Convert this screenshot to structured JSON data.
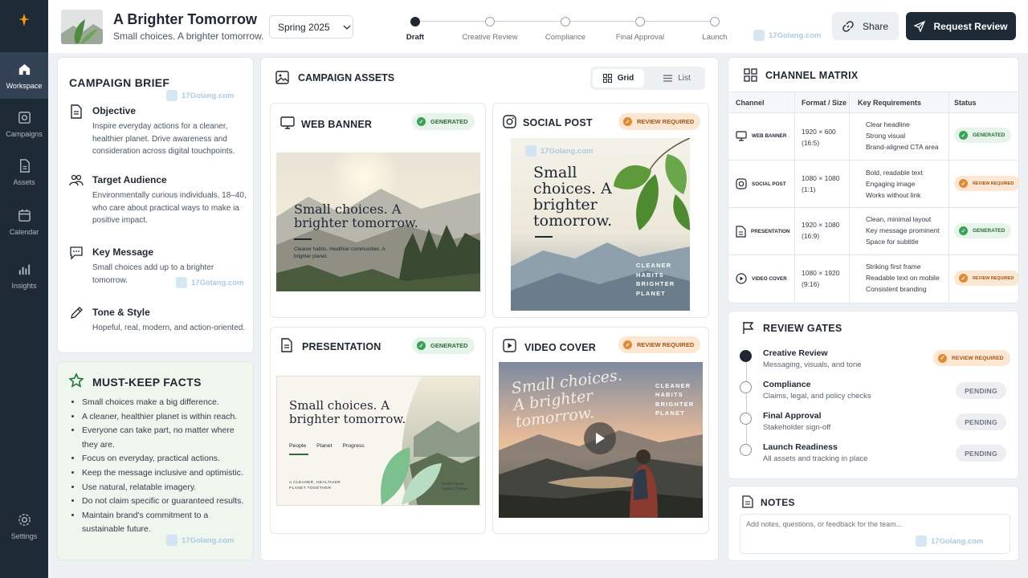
{
  "sidebar": {
    "items": [
      {
        "label": "Workspace",
        "icon": "home-icon",
        "active": true
      },
      {
        "label": "Campaigns",
        "icon": "campaigns-icon"
      },
      {
        "label": "Assets",
        "icon": "assets-icon"
      },
      {
        "label": "Calendar",
        "icon": "calendar-icon"
      },
      {
        "label": "Insights",
        "icon": "insights-icon"
      },
      {
        "label": "Settings",
        "icon": "gear-icon"
      }
    ]
  },
  "header": {
    "title": "A Brighter Tomorrow",
    "subtitle": "Small choices. A brighter tomorrow.",
    "season": "Spring 2025",
    "steps": [
      "Draft",
      "Creative Review",
      "Compliance",
      "Final Approval",
      "Launch"
    ],
    "active_step": "Draft",
    "share_label": "Share",
    "request_label": "Request Review",
    "watermark": "17Golang.com"
  },
  "brief": {
    "title": "CAMPAIGN BRIEF",
    "items": [
      {
        "title": "Objective",
        "text": "Inspire everyday actions for a cleaner, healthier planet. Drive awareness and consideration across digital touchpoints.",
        "icon": "document-icon"
      },
      {
        "title": "Target Audience",
        "text": "Environmentally curious individuals, 18–40, who care about practical ways to make ia positive impact.",
        "icon": "audience-icon"
      },
      {
        "title": "Key Message",
        "text": "Small choices add up to a brighter tomorrow.",
        "icon": "message-icon"
      },
      {
        "title": "Tone & Style",
        "text": "Hopeful, real, modern, and action-oriented.",
        "icon": "pen-icon"
      }
    ]
  },
  "facts": {
    "title": "MUST-KEEP FACTS",
    "items": [
      "Small choices make a big difference.",
      "A cleaner, healthier planet is within reach.",
      "Everyone can take part, no matter where they are.",
      "Focus on everyday, practical actions.",
      "Keep the message inclusive and optimistic.",
      "Use natural, relatable imagery.",
      "Do not claim specific or guaranteed results.",
      "Maintain brand's commitment to a sustainable future."
    ]
  },
  "assets": {
    "title": "CAMPAIGN ASSETS",
    "view_grid": "Grid",
    "view_list": "List",
    "web": {
      "title": "WEB BANNER",
      "status": "GENERATED",
      "headline": "Small choices. A brighter tomorrow.",
      "copy": "Cleaner habits. Healthier communities. A brighter planet."
    },
    "social": {
      "title": "SOCIAL POST",
      "status": "REVIEW REQUIRED",
      "headline": "Small choices. A brighter tomorrow.",
      "tag": [
        "CLEANER",
        "HABITS",
        "BRIGHTER",
        "PLANET"
      ]
    },
    "presentation": {
      "title": "PRESENTATION",
      "status": "GENERATED",
      "headline": "Small choices. A brighter tomorrow.",
      "nav": [
        "People",
        "Planet",
        "Progress"
      ],
      "footer_left": "A CLEANER, HEALTHIER PLANET TOGETHER",
      "footer_right": "Small Actions Lasting Change"
    },
    "video": {
      "title": "VIDEO COVER",
      "status": "REVIEW REQUIRED",
      "headline": "Small choices. A brighter tomorrow.",
      "tag": [
        "CLEANER",
        "HABITS",
        "BRIGHTER",
        "PLANET"
      ]
    }
  },
  "matrix": {
    "title": "CHANNEL MATRIX",
    "columns": [
      "Channel",
      "Format / Size",
      "Key Requirements",
      "Status"
    ],
    "rows": [
      {
        "channel": "WEB BANNER",
        "icon": "monitor-icon",
        "format": [
          "1920 × 600",
          "(16:5)"
        ],
        "reqs": [
          "Clear headline",
          "Strong visual",
          "Brand-aligned CTA area"
        ],
        "status": "GENERATED",
        "kind": "gen"
      },
      {
        "channel": "SOCIAL POST",
        "icon": "instagram-icon",
        "format": [
          "1080 × 1080",
          "(1:1)"
        ],
        "reqs": [
          "Bold, readable text",
          "Engaging image",
          "Works without link"
        ],
        "status": "REVIEW REQUIRED",
        "kind": "rev"
      },
      {
        "channel": "PRESENTATION",
        "icon": "document-icon",
        "format": [
          "1920 × 1080",
          "(16:9)"
        ],
        "reqs": [
          "Clean, minimal layout",
          "Key message prominent",
          "Space for subtitle"
        ],
        "status": "GENERATED",
        "kind": "gen"
      },
      {
        "channel": "VIDEO COVER",
        "icon": "play-icon",
        "format": [
          "1080 × 1920",
          "(9:16)"
        ],
        "reqs": [
          "Striking first frame",
          "Readable text on mobile",
          "Consistent branding"
        ],
        "status": "REVIEW REQUIRED",
        "kind": "rev"
      }
    ]
  },
  "gates": {
    "title": "REVIEW GATES",
    "items": [
      {
        "title": "Creative Review",
        "sub": "Messaging, visuals, and tone",
        "status": "REVIEW REQUIRED"
      },
      {
        "title": "Compliance",
        "sub": "Claims, legal, and policy checks",
        "status": "PENDING"
      },
      {
        "title": "Final Approval",
        "sub": "Stakeholder sign-off",
        "status": "PENDING"
      },
      {
        "title": "Launch Readiness",
        "sub": "All assets and tracking in place",
        "status": "PENDING"
      }
    ]
  },
  "notes": {
    "title": "NOTES",
    "placeholder": "Add notes, questions, or feedback for the team..."
  },
  "colors": {
    "sidebar": "#1f2a37",
    "accent": "#f59e0b",
    "generated": "#3aa35a",
    "review": "#e08a36"
  }
}
